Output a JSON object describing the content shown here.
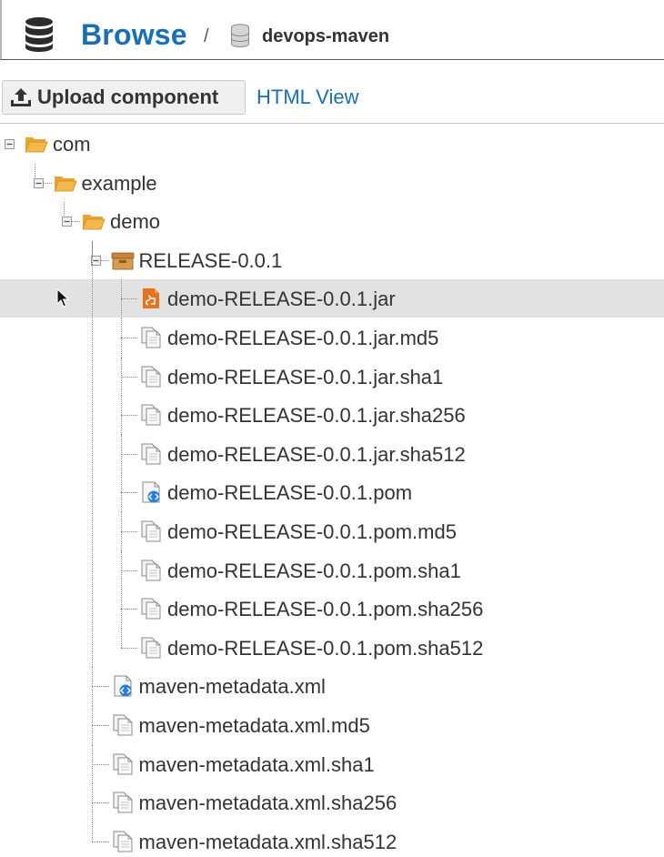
{
  "header": {
    "browse_label": "Browse",
    "separator": "/",
    "repository_name": "devops-maven"
  },
  "toolbar": {
    "upload_label": "Upload component",
    "html_view_label": "HTML View"
  },
  "tree": {
    "folders": [
      {
        "label": "com",
        "icon": "folder-open-icon"
      },
      {
        "label": "example",
        "icon": "folder-open-icon"
      },
      {
        "label": "demo",
        "icon": "folder-open-icon"
      },
      {
        "label": "RELEASE-0.0.1",
        "icon": "package-icon"
      }
    ],
    "version_files": [
      {
        "label": "demo-RELEASE-0.0.1.jar",
        "icon": "jar-file-icon",
        "selected": true
      },
      {
        "label": "demo-RELEASE-0.0.1.jar.md5",
        "icon": "file-copy-icon"
      },
      {
        "label": "demo-RELEASE-0.0.1.jar.sha1",
        "icon": "file-copy-icon"
      },
      {
        "label": "demo-RELEASE-0.0.1.jar.sha256",
        "icon": "file-copy-icon"
      },
      {
        "label": "demo-RELEASE-0.0.1.jar.sha512",
        "icon": "file-copy-icon"
      },
      {
        "label": "demo-RELEASE-0.0.1.pom",
        "icon": "xml-file-icon"
      },
      {
        "label": "demo-RELEASE-0.0.1.pom.md5",
        "icon": "file-copy-icon"
      },
      {
        "label": "demo-RELEASE-0.0.1.pom.sha1",
        "icon": "file-copy-icon"
      },
      {
        "label": "demo-RELEASE-0.0.1.pom.sha256",
        "icon": "file-copy-icon"
      },
      {
        "label": "demo-RELEASE-0.0.1.pom.sha512",
        "icon": "file-copy-icon"
      }
    ],
    "metadata_files": [
      {
        "label": "maven-metadata.xml",
        "icon": "xml-file-icon"
      },
      {
        "label": "maven-metadata.xml.md5",
        "icon": "file-copy-icon"
      },
      {
        "label": "maven-metadata.xml.sha1",
        "icon": "file-copy-icon"
      },
      {
        "label": "maven-metadata.xml.sha256",
        "icon": "file-copy-icon"
      },
      {
        "label": "maven-metadata.xml.sha512",
        "icon": "file-copy-icon"
      }
    ]
  },
  "colors": {
    "link": "#1a6fb3",
    "selected_row": "#e2e2e2",
    "folder": "#f2b84b",
    "jar": "#e8731f",
    "xml_badge": "#2a7fd4"
  }
}
